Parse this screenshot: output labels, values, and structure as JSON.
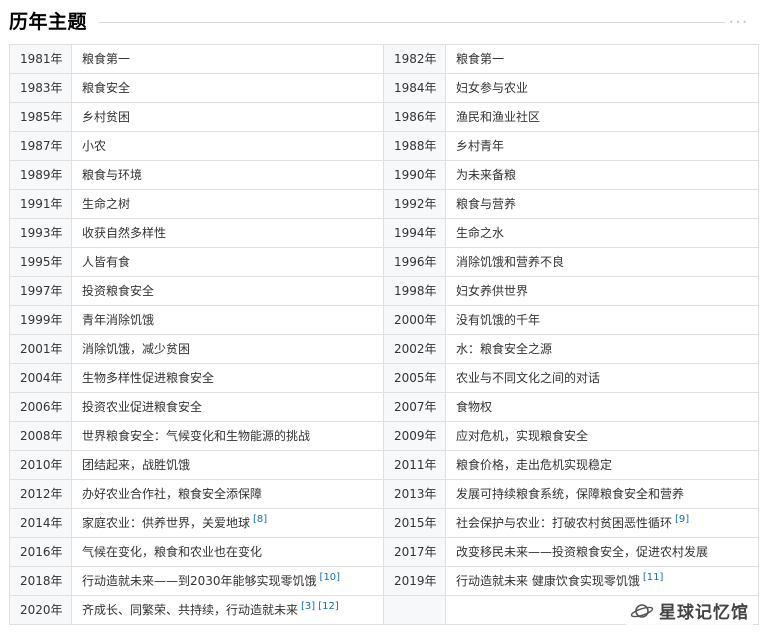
{
  "header": {
    "title": "历年主题"
  },
  "watermark": {
    "text": "星球记忆馆"
  },
  "rows": [
    {
      "left": {
        "year": "1981年",
        "theme": "粮食第一"
      },
      "right": {
        "year": "1982年",
        "theme": "粮食第一"
      }
    },
    {
      "left": {
        "year": "1983年",
        "theme": "粮食安全"
      },
      "right": {
        "year": "1984年",
        "theme": "妇女参与农业"
      }
    },
    {
      "left": {
        "year": "1985年",
        "theme": "乡村贫困"
      },
      "right": {
        "year": "1986年",
        "theme": "渔民和渔业社区"
      }
    },
    {
      "left": {
        "year": "1987年",
        "theme": "小农"
      },
      "right": {
        "year": "1988年",
        "theme": "乡村青年"
      }
    },
    {
      "left": {
        "year": "1989年",
        "theme": "粮食与环境"
      },
      "right": {
        "year": "1990年",
        "theme": "为未来备粮"
      }
    },
    {
      "left": {
        "year": "1991年",
        "theme": "生命之树"
      },
      "right": {
        "year": "1992年",
        "theme": "粮食与营养"
      }
    },
    {
      "left": {
        "year": "1993年",
        "theme": "收获自然多样性"
      },
      "right": {
        "year": "1994年",
        "theme": "生命之水"
      }
    },
    {
      "left": {
        "year": "1995年",
        "theme": "人皆有食"
      },
      "right": {
        "year": "1996年",
        "theme": "消除饥饿和营养不良"
      }
    },
    {
      "left": {
        "year": "1997年",
        "theme": "投资粮食安全"
      },
      "right": {
        "year": "1998年",
        "theme": "妇女养供世界"
      }
    },
    {
      "left": {
        "year": "1999年",
        "theme": "青年消除饥饿"
      },
      "right": {
        "year": "2000年",
        "theme": "没有饥饿的千年"
      }
    },
    {
      "left": {
        "year": "2001年",
        "theme": "消除饥饿，减少贫困"
      },
      "right": {
        "year": "2002年",
        "theme": "水：粮食安全之源"
      }
    },
    {
      "left": {
        "year": "2004年",
        "theme": "生物多样性促进粮食安全"
      },
      "right": {
        "year": "2005年",
        "theme": "农业与不同文化之间的对话"
      }
    },
    {
      "left": {
        "year": "2006年",
        "theme": "投资农业促进粮食安全"
      },
      "right": {
        "year": "2007年",
        "theme": "食物权"
      }
    },
    {
      "left": {
        "year": "2008年",
        "theme": "世界粮食安全：气候变化和生物能源的挑战"
      },
      "right": {
        "year": "2009年",
        "theme": "应对危机，实现粮食安全"
      }
    },
    {
      "left": {
        "year": "2010年",
        "theme": "团结起来，战胜饥饿"
      },
      "right": {
        "year": "2011年",
        "theme": "粮食价格，走出危机实现稳定"
      }
    },
    {
      "left": {
        "year": "2012年",
        "theme": "办好农业合作社，粮食安全添保障"
      },
      "right": {
        "year": "2013年",
        "theme": "发展可持续粮食系统，保障粮食安全和营养"
      }
    },
    {
      "left": {
        "year": "2014年",
        "theme": "家庭农业：供养世界，关爱地球",
        "ref": "[8]"
      },
      "right": {
        "year": "2015年",
        "theme": "社会保护与农业：打破农村贫困恶性循环",
        "ref": "[9]"
      }
    },
    {
      "left": {
        "year": "2016年",
        "theme": "气候在变化，粮食和农业也在变化"
      },
      "right": {
        "year": "2017年",
        "theme": "改变移民未来——投资粮食安全，促进农村发展"
      }
    },
    {
      "left": {
        "year": "2018年",
        "theme": "行动造就未来——到2030年能够实现零饥饿",
        "ref": "[10]"
      },
      "right": {
        "year": "2019年",
        "theme": "行动造就未来 健康饮食实现零饥饿",
        "ref": "[11]"
      }
    },
    {
      "left": {
        "year": "2020年",
        "theme": "齐成长、同繁荣、共持续，行动造就未来",
        "ref": "[3]",
        "ref2": "[12]"
      },
      "right": {
        "year": "",
        "theme": ""
      }
    }
  ]
}
